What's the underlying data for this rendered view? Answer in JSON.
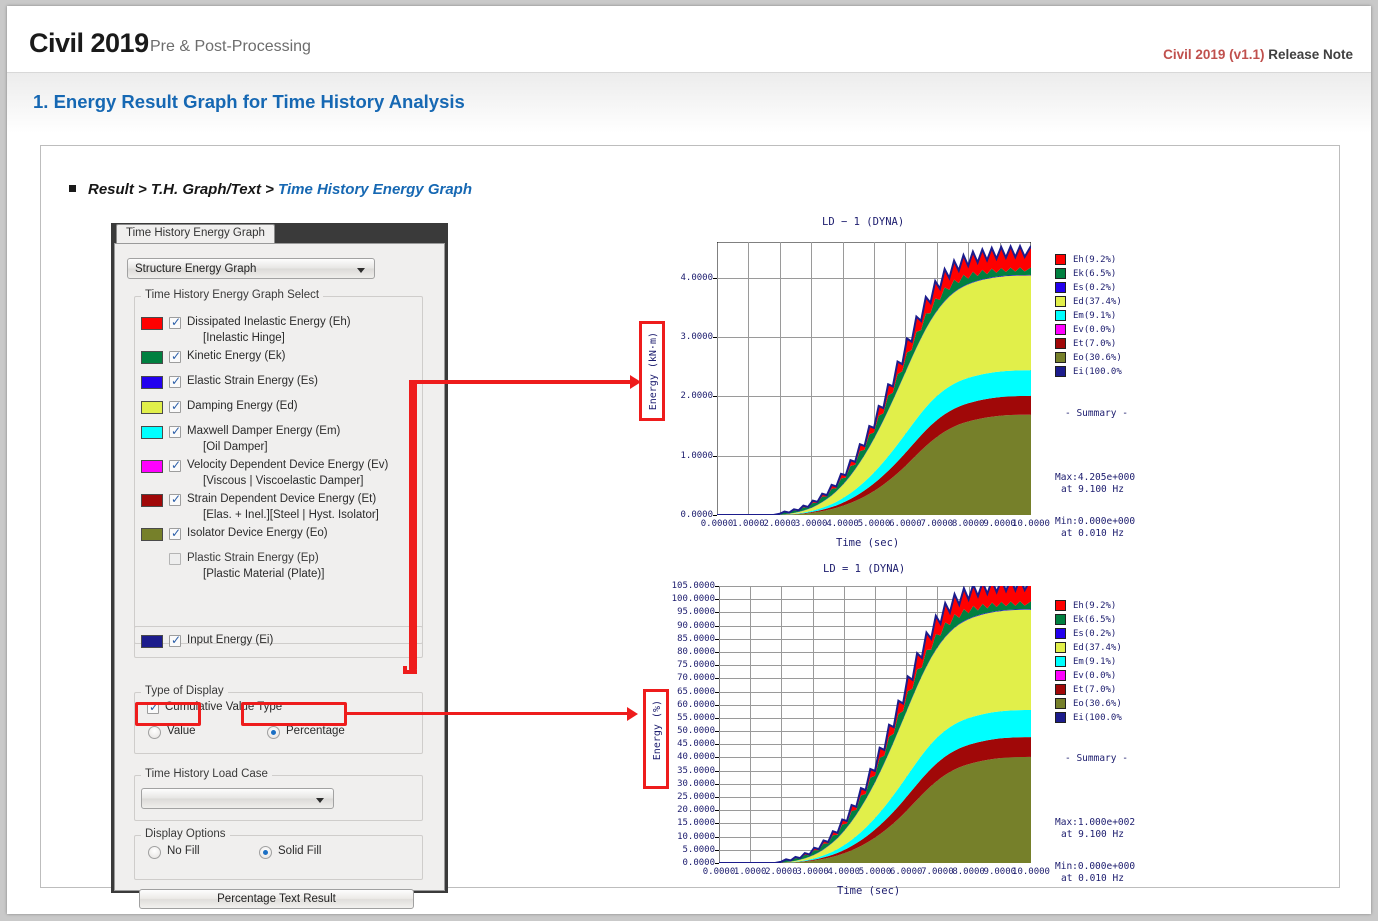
{
  "header": {
    "brand": "Civil 2019",
    "subtitle": "Pre & Post-Processing",
    "release_a": "Civil 2019 (v1.1)",
    "release_b": " Release Note"
  },
  "section": {
    "title": "1. Energy Result Graph for Time History Analysis"
  },
  "breadcrumb": {
    "dark": "Result > T.H. Graph/Text > ",
    "blue": "Time History Energy Graph"
  },
  "dialog": {
    "tab": "Time History Energy Graph",
    "graph_type_combo": "Structure Energy Graph",
    "select_group": "Time History Energy Graph Select",
    "items": [
      {
        "color": "#ff0000",
        "checked": true,
        "label": "Dissipated Inelastic Energy (Eh)",
        "sub": "[Inelastic Hinge]"
      },
      {
        "color": "#008040",
        "checked": true,
        "label": "Kinetic Energy (Ek)",
        "sub": ""
      },
      {
        "color": "#2200ee",
        "checked": true,
        "label": "Elastic Strain Energy (Es)",
        "sub": ""
      },
      {
        "color": "#e1ef4a",
        "checked": true,
        "label": "Damping Energy (Ed)",
        "sub": ""
      },
      {
        "color": "#00ffff",
        "checked": true,
        "label": "Maxwell Damper Energy (Em)",
        "sub": "[Oil Damper]"
      },
      {
        "color": "#ff00ff",
        "checked": true,
        "label": "Velocity Dependent Device Energy (Ev)",
        "sub": "[Viscous | Viscoelastic Damper]"
      },
      {
        "color": "#a00808",
        "checked": true,
        "label": "Strain Dependent Device Energy (Et)",
        "sub": "[Elas. + Inel.][Steel | Hyst. Isolator]"
      },
      {
        "color": "#76802a",
        "checked": true,
        "label": "Isolator Device Energy (Eo)",
        "sub": ""
      },
      {
        "color": "",
        "checked": false,
        "label": "Plastic Strain Energy (Ep)",
        "sub": "[Plastic Material (Plate)]"
      }
    ],
    "input_energy": {
      "color": "#1c1c8c",
      "checked": true,
      "label": "Input Energy (Ei)"
    },
    "type_of_display": {
      "group": "Type of Display",
      "cumulative_label": "Cumulative Value Type",
      "cumulative_checked": true,
      "value_label": "Value",
      "percentage_label": "Percentage",
      "selected": "Percentage"
    },
    "load_case": {
      "group": "Time History Load Case",
      "value": ""
    },
    "display_options": {
      "group": "Display Options",
      "no_fill_label": "No Fill",
      "solid_fill_label": "Solid Fill",
      "selected": "Solid Fill"
    },
    "result_button": "Percentage Text Result"
  },
  "legend_series": [
    {
      "key": "Eh",
      "label": "Eh(9.2%)",
      "color": "#ff0000"
    },
    {
      "key": "Ek",
      "label": "Ek(6.5%)",
      "color": "#008040"
    },
    {
      "key": "Es",
      "label": "Es(0.2%)",
      "color": "#2200ee"
    },
    {
      "key": "Ed",
      "label": "Ed(37.4%)",
      "color": "#e1ef4a"
    },
    {
      "key": "Em",
      "label": "Em(9.1%)",
      "color": "#00ffff"
    },
    {
      "key": "Ev",
      "label": "Ev(0.0%)",
      "color": "#ff00ff"
    },
    {
      "key": "Et",
      "label": "Et(7.0%)",
      "color": "#a00808"
    },
    {
      "key": "Eo",
      "label": "Eo(30.6%)",
      "color": "#76802a"
    },
    {
      "key": "Ei",
      "label": "Ei(100.0%",
      "color": "#1c1c8c"
    }
  ],
  "chart_data": [
    {
      "id": "top",
      "type": "area",
      "title": "LD − 1  (DYNA)",
      "xlabel": "Time (sec)",
      "ylabel": "Energy (kN·m)",
      "xlim": [
        0,
        10
      ],
      "ylim": [
        0,
        4.6
      ],
      "xticks": [
        "0.0000",
        "1.0000",
        "2.0000",
        "3.0000",
        "4.0000",
        "5.0000",
        "6.0000",
        "7.0000",
        "8.0000",
        "9.0000",
        "10.0000"
      ],
      "yticks": [
        "0.0000",
        "1.0000",
        "2.0000",
        "3.0000",
        "4.0000"
      ],
      "ytick_values": [
        0,
        1,
        2,
        3,
        4
      ],
      "grid": true,
      "scale": 4.205,
      "legend_position": "right",
      "summary": {
        "heading": "-  Summary  -",
        "max": "Max:4.205e+000",
        "max_at": "at   9.100 Hz",
        "min": "Min:0.000e+000",
        "min_at": "at   0.010 Hz"
      },
      "x": [
        0,
        0.3,
        0.6,
        0.9,
        1.2,
        1.5,
        1.8,
        2.0,
        2.15,
        2.3,
        2.45,
        2.6,
        2.75,
        2.9,
        3.05,
        3.2,
        3.35,
        3.5,
        3.65,
        3.8,
        3.95,
        4.1,
        4.25,
        4.4,
        4.55,
        4.7,
        4.85,
        5.0,
        5.15,
        5.3,
        5.45,
        5.6,
        5.75,
        5.9,
        6.05,
        6.2,
        6.35,
        6.5,
        6.65,
        6.8,
        6.95,
        7.1,
        7.25,
        7.4,
        7.55,
        7.7,
        7.85,
        8.0,
        8.15,
        8.3,
        8.45,
        8.6,
        8.75,
        8.9,
        9.05,
        9.2,
        9.35,
        9.5,
        9.65,
        9.8,
        10.0
      ],
      "series": [
        {
          "name": "Eo",
          "color": "#76802a",
          "values": [
            0,
            0,
            0,
            0,
            0,
            0,
            0,
            0.002,
            0.004,
            0.006,
            0.01,
            0.016,
            0.022,
            0.03,
            0.04,
            0.052,
            0.066,
            0.082,
            0.1,
            0.12,
            0.145,
            0.172,
            0.202,
            0.235,
            0.272,
            0.312,
            0.356,
            0.404,
            0.456,
            0.512,
            0.572,
            0.636,
            0.704,
            0.776,
            0.852,
            0.93,
            1.008,
            1.086,
            1.16,
            1.23,
            1.294,
            1.352,
            1.404,
            1.45,
            1.49,
            1.524,
            1.552,
            1.576,
            1.596,
            1.614,
            1.63,
            1.644,
            1.656,
            1.666,
            1.674,
            1.68,
            1.684,
            1.687,
            1.689,
            1.69,
            1.691
          ]
        },
        {
          "name": "Et",
          "color": "#a00808",
          "values": [
            0,
            0,
            0,
            0,
            0,
            0,
            0,
            0.001,
            0.002,
            0.003,
            0.004,
            0.006,
            0.008,
            0.011,
            0.014,
            0.018,
            0.023,
            0.028,
            0.034,
            0.041,
            0.049,
            0.058,
            0.068,
            0.079,
            0.091,
            0.103,
            0.116,
            0.129,
            0.143,
            0.157,
            0.171,
            0.185,
            0.199,
            0.212,
            0.225,
            0.237,
            0.248,
            0.258,
            0.267,
            0.275,
            0.282,
            0.288,
            0.293,
            0.297,
            0.3,
            0.303,
            0.305,
            0.307,
            0.309,
            0.31,
            0.311,
            0.312,
            0.313,
            0.314,
            0.314,
            0.315,
            0.315,
            0.315,
            0.316,
            0.316,
            0.316
          ]
        },
        {
          "name": "Em",
          "color": "#00ffff",
          "values": [
            0,
            0,
            0,
            0,
            0,
            0,
            0,
            0.001,
            0.002,
            0.003,
            0.005,
            0.008,
            0.011,
            0.015,
            0.02,
            0.026,
            0.033,
            0.041,
            0.05,
            0.06,
            0.072,
            0.085,
            0.099,
            0.114,
            0.13,
            0.147,
            0.165,
            0.184,
            0.204,
            0.224,
            0.245,
            0.266,
            0.287,
            0.307,
            0.326,
            0.344,
            0.36,
            0.374,
            0.386,
            0.396,
            0.404,
            0.41,
            0.415,
            0.419,
            0.422,
            0.424,
            0.426,
            0.427,
            0.428,
            0.429,
            0.43,
            0.43,
            0.431,
            0.431,
            0.431,
            0.432,
            0.432,
            0.432,
            0.432,
            0.432,
            0.432
          ]
        },
        {
          "name": "Ev",
          "color": "#ff00ff",
          "values": [
            0,
            0,
            0,
            0,
            0,
            0,
            0,
            0,
            0,
            0,
            0,
            0,
            0,
            0,
            0,
            0,
            0,
            0,
            0,
            0,
            0,
            0,
            0,
            0,
            0,
            0,
            0,
            0,
            0,
            0,
            0,
            0,
            0,
            0,
            0,
            0,
            0,
            0,
            0,
            0,
            0,
            0,
            0,
            0,
            0,
            0,
            0,
            0,
            0,
            0,
            0,
            0,
            0,
            0,
            0,
            0,
            0,
            0,
            0,
            0,
            0
          ]
        },
        {
          "name": "Ed",
          "color": "#e1ef4a",
          "values": [
            0,
            0,
            0,
            0,
            0,
            0,
            0,
            0.002,
            0.005,
            0.009,
            0.014,
            0.021,
            0.03,
            0.041,
            0.055,
            0.072,
            0.092,
            0.116,
            0.143,
            0.174,
            0.209,
            0.248,
            0.291,
            0.338,
            0.389,
            0.444,
            0.503,
            0.565,
            0.63,
            0.698,
            0.768,
            0.84,
            0.913,
            0.986,
            1.058,
            1.128,
            1.195,
            1.258,
            1.316,
            1.368,
            1.414,
            1.453,
            1.486,
            1.513,
            1.535,
            1.552,
            1.565,
            1.575,
            1.582,
            1.587,
            1.59,
            1.592,
            1.594,
            1.595,
            1.596,
            1.597,
            1.597,
            1.598,
            1.598,
            1.598,
            1.598
          ]
        },
        {
          "name": "Es",
          "color": "#2200ee",
          "values": [
            0,
            0,
            0,
            0,
            0,
            0,
            0,
            0.001,
            0.002,
            0.002,
            0.003,
            0.003,
            0.004,
            0.004,
            0.005,
            0.005,
            0.005,
            0.006,
            0.006,
            0.007,
            0.007,
            0.007,
            0.008,
            0.008,
            0.008,
            0.008,
            0.009,
            0.009,
            0.009,
            0.009,
            0.009,
            0.009,
            0.009,
            0.009,
            0.009,
            0.009,
            0.009,
            0.009,
            0.009,
            0.009,
            0.009,
            0.009,
            0.009,
            0.009,
            0.009,
            0.009,
            0.009,
            0.009,
            0.009,
            0.009,
            0.009,
            0.009,
            0.009,
            0.009,
            0.009,
            0.009,
            0.009,
            0.009,
            0.009,
            0.009,
            0.009
          ]
        },
        {
          "name": "Ek",
          "color": "#008040",
          "values": [
            0,
            0,
            0,
            0,
            0,
            0,
            0,
            0.01,
            0.03,
            0.012,
            0.04,
            0.016,
            0.055,
            0.022,
            0.07,
            0.03,
            0.09,
            0.038,
            0.11,
            0.048,
            0.132,
            0.06,
            0.158,
            0.072,
            0.185,
            0.086,
            0.21,
            0.1,
            0.232,
            0.112,
            0.25,
            0.124,
            0.262,
            0.13,
            0.268,
            0.132,
            0.266,
            0.13,
            0.258,
            0.124,
            0.244,
            0.116,
            0.228,
            0.106,
            0.21,
            0.096,
            0.192,
            0.086,
            0.175,
            0.078,
            0.16,
            0.072,
            0.148,
            0.066,
            0.138,
            0.062,
            0.132,
            0.06,
            0.128,
            0.058,
            0.126
          ]
        },
        {
          "name": "Eh",
          "color": "#ff0000",
          "values": [
            0,
            0,
            0,
            0,
            0,
            0,
            0,
            0.004,
            0.014,
            0.006,
            0.02,
            0.009,
            0.028,
            0.013,
            0.038,
            0.018,
            0.05,
            0.024,
            0.064,
            0.031,
            0.08,
            0.04,
            0.098,
            0.05,
            0.118,
            0.062,
            0.14,
            0.076,
            0.164,
            0.09,
            0.188,
            0.106,
            0.212,
            0.122,
            0.236,
            0.14,
            0.258,
            0.156,
            0.278,
            0.172,
            0.294,
            0.186,
            0.308,
            0.198,
            0.32,
            0.21,
            0.33,
            0.22,
            0.338,
            0.228,
            0.345,
            0.234,
            0.35,
            0.238,
            0.354,
            0.242,
            0.357,
            0.245,
            0.359,
            0.247,
            0.36
          ]
        }
      ]
    },
    {
      "id": "bottom",
      "type": "area",
      "title": "LD = 1  (DYNA)",
      "xlabel": "Time (sec)",
      "ylabel": "Energy (%)",
      "xlim": [
        0,
        10
      ],
      "ylim": [
        0,
        105
      ],
      "xticks": [
        "0.0000",
        "1.0000",
        "2.0000",
        "3.0000",
        "4.0000",
        "5.0000",
        "6.0000",
        "7.0000",
        "8.0000",
        "9.0000",
        "10.0000"
      ],
      "yticks": [
        "0.0000",
        "5.0000",
        "10.0000",
        "15.0000",
        "20.0000",
        "25.0000",
        "30.0000",
        "35.0000",
        "40.0000",
        "45.0000",
        "50.0000",
        "55.0000",
        "60.0000",
        "65.0000",
        "70.0000",
        "75.0000",
        "80.0000",
        "85.0000",
        "90.0000",
        "95.0000",
        "100.0000",
        "105.0000"
      ],
      "ytick_values": [
        0,
        5,
        10,
        15,
        20,
        25,
        30,
        35,
        40,
        45,
        50,
        55,
        60,
        65,
        70,
        75,
        80,
        85,
        90,
        95,
        100,
        105
      ],
      "grid": true,
      "scale": 100,
      "legend_position": "right",
      "summary": {
        "heading": "-  Summary  -",
        "max": "Max:1.000e+002",
        "max_at": "at   9.100 Hz",
        "min": "Min:0.000e+000",
        "min_at": "at   0.010 Hz"
      }
    }
  ]
}
